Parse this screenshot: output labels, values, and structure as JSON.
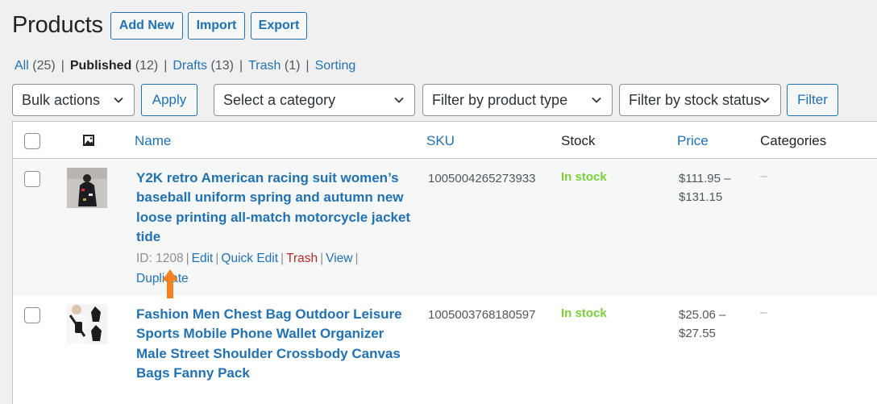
{
  "page": {
    "title": "Products",
    "buttons": {
      "add_new": "Add New",
      "import": "Import",
      "export": "Export"
    }
  },
  "views": [
    {
      "label": "All",
      "count": "(25)",
      "current": false
    },
    {
      "label": "Published",
      "count": "(12)",
      "current": true
    },
    {
      "label": "Drafts",
      "count": "(13)",
      "current": false
    },
    {
      "label": "Trash",
      "count": "(1)",
      "current": false
    },
    {
      "label": "Sorting",
      "count": "",
      "current": false
    }
  ],
  "filters": {
    "bulk_actions": "Bulk actions",
    "apply": "Apply",
    "category": "Select a category",
    "product_type": "Filter by product type",
    "stock_status": "Filter by stock status",
    "filter": "Filter"
  },
  "table": {
    "headers": {
      "name": "Name",
      "sku": "SKU",
      "stock": "Stock",
      "price": "Price",
      "categories": "Categories"
    },
    "thumb_header_icon": "image-icon",
    "rows": [
      {
        "name": "Y2K retro American racing suit women’s baseball uniform spring and autumn new loose printing all-match motorcycle jacket tide",
        "id_text": "ID: 1208",
        "actions": {
          "edit": "Edit",
          "quick_edit": "Quick Edit",
          "trash": "Trash",
          "view": "View",
          "duplicate": "Duplicate"
        },
        "sku": "1005004265273933",
        "stock": "In stock",
        "price_from": "$111.95 –",
        "price_to": "$131.15",
        "categories": "–"
      },
      {
        "name": "Fashion Men Chest Bag Outdoor Leisure Sports Mobile Phone Wallet Organizer Male Street Shoulder Crossbody Canvas Bags Fanny Pack",
        "sku": "1005003768180597",
        "stock": "In stock",
        "price_from": "$25.06 –",
        "price_to": "$27.55",
        "categories": "–"
      }
    ]
  },
  "colors": {
    "accent": "#2271b1",
    "in_stock": "#7ad03a",
    "trash": "#b32d2e",
    "annotation_arrow": "#f5821f"
  }
}
